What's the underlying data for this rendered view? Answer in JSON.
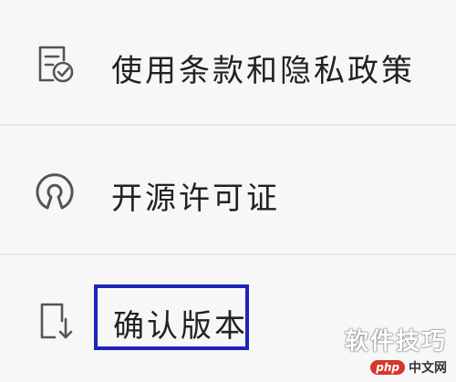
{
  "settings": {
    "items": [
      {
        "label": "使用条款和隐私政策",
        "icon": "terms-checked-doc-icon"
      },
      {
        "label": "开源许可证",
        "icon": "open-source-license-icon"
      },
      {
        "label": "确认版本",
        "icon": "download-version-icon"
      }
    ],
    "highlight_color": "#1f23b8"
  },
  "watermark": {
    "title": "软件技巧",
    "badge": "php",
    "site": "中文网"
  }
}
